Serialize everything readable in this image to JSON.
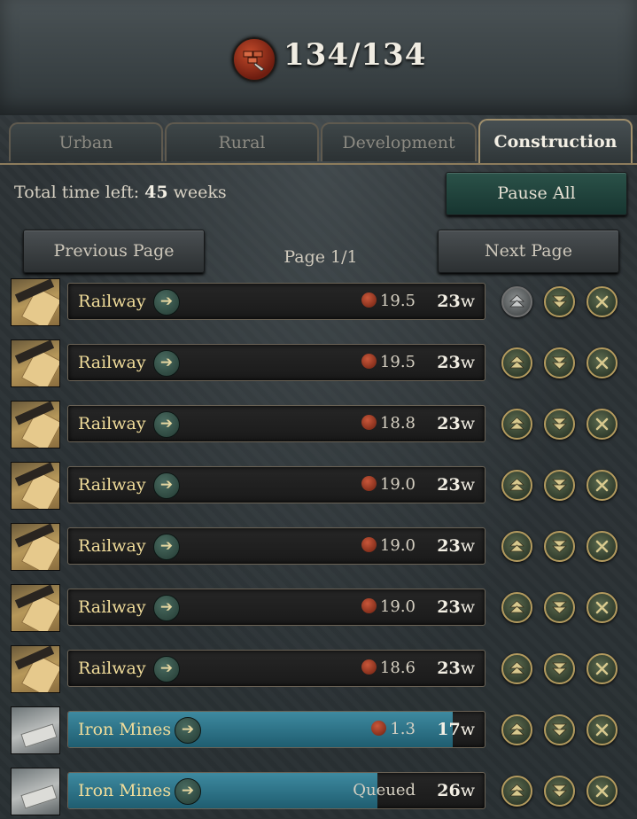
{
  "header": {
    "capacity_icon": "construction-brick-icon",
    "capacity": "134/134"
  },
  "tabs": [
    {
      "label": "Urban",
      "active": false
    },
    {
      "label": "Rural",
      "active": false
    },
    {
      "label": "Development",
      "active": false
    },
    {
      "label": "Construction",
      "active": true
    }
  ],
  "summary": {
    "time_left_label": "Total time left:",
    "time_left_value": "45",
    "time_left_unit": "weeks",
    "pause_all_label": "Pause All"
  },
  "pagination": {
    "previous_label": "Previous Page",
    "next_label": "Next Page",
    "page_indicator": "Page 1/1"
  },
  "queue": [
    {
      "name": "Railway",
      "icon": "railway-icon",
      "cost": "19.5",
      "weeks": "23",
      "progress": 0,
      "move_up_enabled": false
    },
    {
      "name": "Railway",
      "icon": "railway-icon",
      "cost": "19.5",
      "weeks": "23",
      "progress": 0,
      "move_up_enabled": true
    },
    {
      "name": "Railway",
      "icon": "railway-icon",
      "cost": "18.8",
      "weeks": "23",
      "progress": 0,
      "move_up_enabled": true
    },
    {
      "name": "Railway",
      "icon": "railway-icon",
      "cost": "19.0",
      "weeks": "23",
      "progress": 0,
      "move_up_enabled": true
    },
    {
      "name": "Railway",
      "icon": "railway-icon",
      "cost": "19.0",
      "weeks": "23",
      "progress": 0,
      "move_up_enabled": true
    },
    {
      "name": "Railway",
      "icon": "railway-icon",
      "cost": "19.0",
      "weeks": "23",
      "progress": 0,
      "move_up_enabled": true
    },
    {
      "name": "Railway",
      "icon": "railway-icon",
      "cost": "18.6",
      "weeks": "23",
      "progress": 0,
      "move_up_enabled": true
    },
    {
      "name": "Iron Mines",
      "icon": "iron-mine-icon",
      "cost": "1.3",
      "weeks": "17",
      "progress": 0.92,
      "move_up_enabled": true
    },
    {
      "name": "Iron Mines",
      "icon": "iron-mine-icon",
      "status": "Queued",
      "weeks": "26",
      "progress": 0.74,
      "move_up_enabled": true
    }
  ],
  "week_suffix": "w",
  "colors": {
    "progress_fill": "#3e8aa0",
    "accent_gold": "#b39a5e",
    "name_text": "#f0dc9a"
  }
}
